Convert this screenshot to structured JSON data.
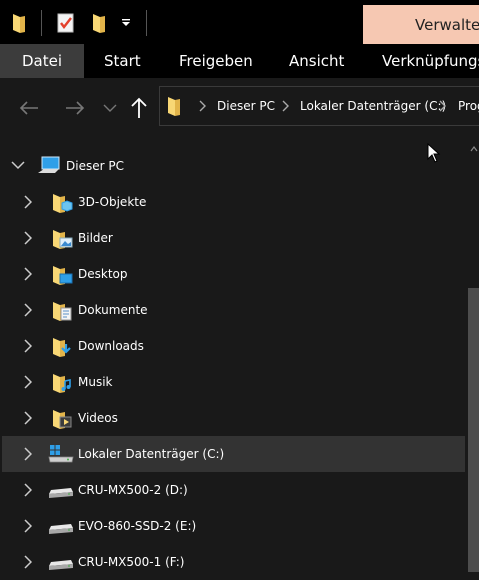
{
  "title_bar": {
    "manage_tab_label": "Verwalten"
  },
  "quick_access": {
    "icons": [
      "folder-icon",
      "properties-icon",
      "new-folder-icon",
      "customize-dropdown-icon"
    ]
  },
  "ribbon": {
    "tabs": [
      {
        "label": "Datei",
        "active": true
      },
      {
        "label": "Start"
      },
      {
        "label": "Freigeben"
      },
      {
        "label": "Ansicht"
      },
      {
        "label": "Verknüpfungs"
      }
    ]
  },
  "navigation": {
    "back_icon": "arrow-left-icon",
    "forward_icon": "arrow-right-icon",
    "recent_icon": "chevron-down-icon",
    "up_icon": "arrow-up-icon"
  },
  "address_bar": {
    "breadcrumbs": [
      "Dieser PC",
      "Lokaler Datenträger (C:)",
      "Prog"
    ]
  },
  "tree": {
    "root": {
      "label": "Dieser PC",
      "icon": "computer-icon",
      "expanded": true
    },
    "items": [
      {
        "label": "3D-Objekte",
        "icon": "3d-objects-folder-icon"
      },
      {
        "label": "Bilder",
        "icon": "pictures-folder-icon"
      },
      {
        "label": "Desktop",
        "icon": "desktop-folder-icon"
      },
      {
        "label": "Dokumente",
        "icon": "documents-folder-icon"
      },
      {
        "label": "Downloads",
        "icon": "downloads-folder-icon"
      },
      {
        "label": "Musik",
        "icon": "music-folder-icon"
      },
      {
        "label": "Videos",
        "icon": "videos-folder-icon"
      },
      {
        "label": "Lokaler Datenträger (C:)",
        "icon": "windows-drive-icon",
        "selected": true
      },
      {
        "label": "CRU-MX500-2 (D:)",
        "icon": "drive-icon"
      },
      {
        "label": "EVO-860-SSD-2 (E:)",
        "icon": "drive-icon"
      },
      {
        "label": "CRU-MX500-1 (F:)",
        "icon": "drive-icon"
      }
    ]
  },
  "colors": {
    "background": "#191919",
    "chrome": "#000000",
    "manage_tab": "#f6c8b2",
    "active_tab": "#3c3c3c",
    "selected_row": "#333333",
    "folder_yellow": "#f8d775",
    "accent_blue": "#2f9fe8"
  }
}
